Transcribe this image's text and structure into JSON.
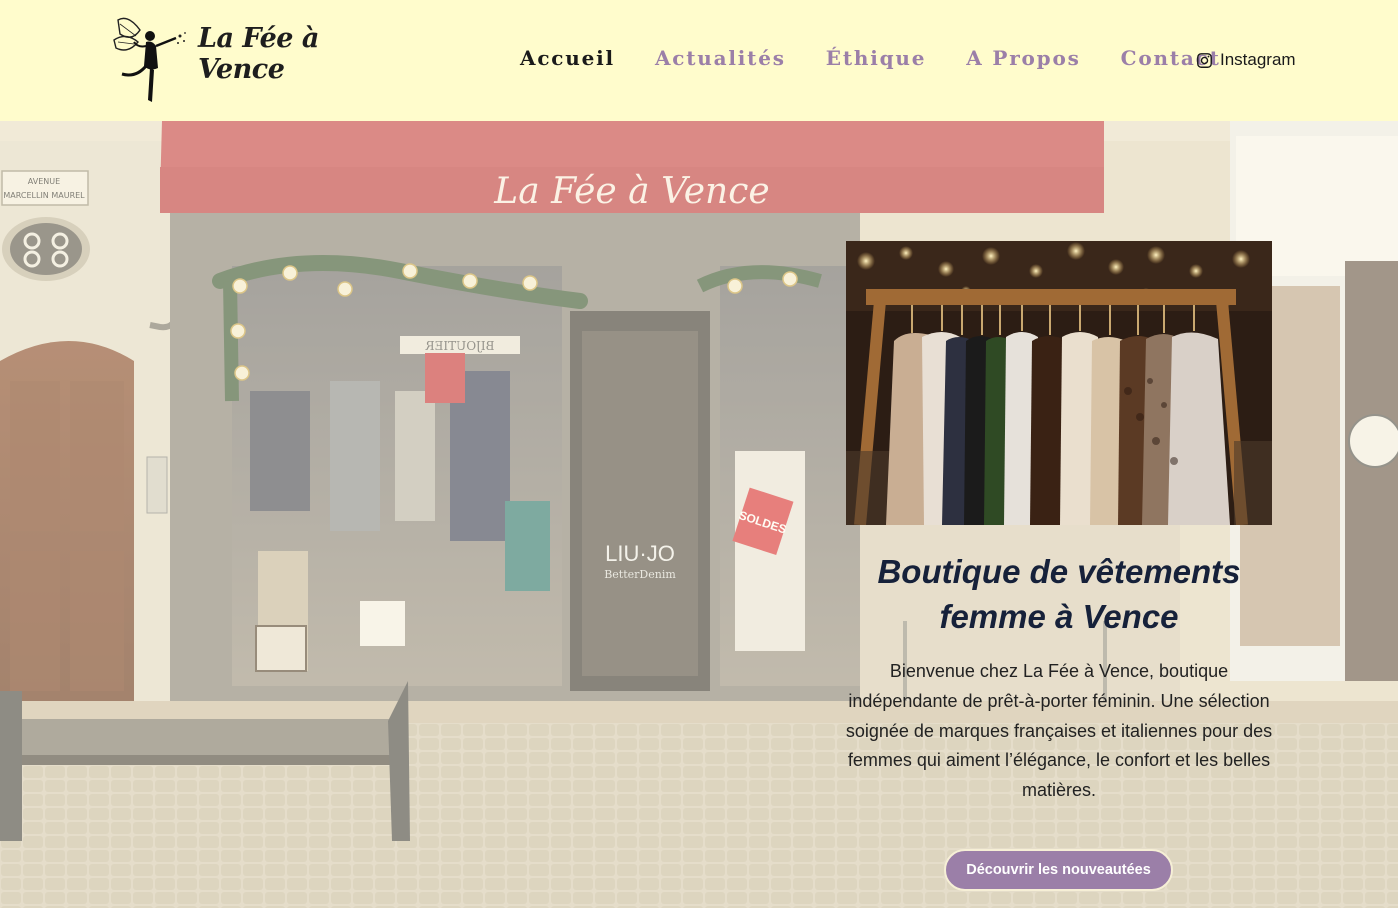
{
  "site": {
    "name": "La Fée à Vence",
    "logo_icon": "fairy-silhouette-icon"
  },
  "nav": {
    "items": [
      {
        "label": "Accueil",
        "active": true
      },
      {
        "label": "Actualités",
        "active": false
      },
      {
        "label": "Éthique",
        "active": false
      },
      {
        "label": "A Propos",
        "active": false
      },
      {
        "label": "Contact",
        "active": false
      }
    ],
    "instagram": {
      "label": "Instagram",
      "icon": "instagram-icon"
    }
  },
  "hero": {
    "awning_text": "La Fée à Vence",
    "street_sign_line1": "AVENUE",
    "street_sign_line2": "MARCELLIN MAUREL",
    "shop_sign_text": "BIJOUTIER",
    "door_brand": "LIU·JO",
    "door_brand_sub": "BetterDenim",
    "sale_tag": "SOLDES",
    "title": "Boutique de vêtements femme à Vence",
    "description": "Bienvenue chez La Fée à Vence, boutique indépendante de prêt-à-porter féminin. Une sélection soignée de marques françaises et italiennes pour des femmes qui aiment l’élégance, le confort et les belles matières.",
    "cta_label": "Découvrir les nouveautées"
  },
  "colors": {
    "header_bg": "#fffccc",
    "nav_accent": "#9b7fa8",
    "nav_active": "#1a1a1a",
    "awning": "#c5464c",
    "title": "#16213a"
  }
}
